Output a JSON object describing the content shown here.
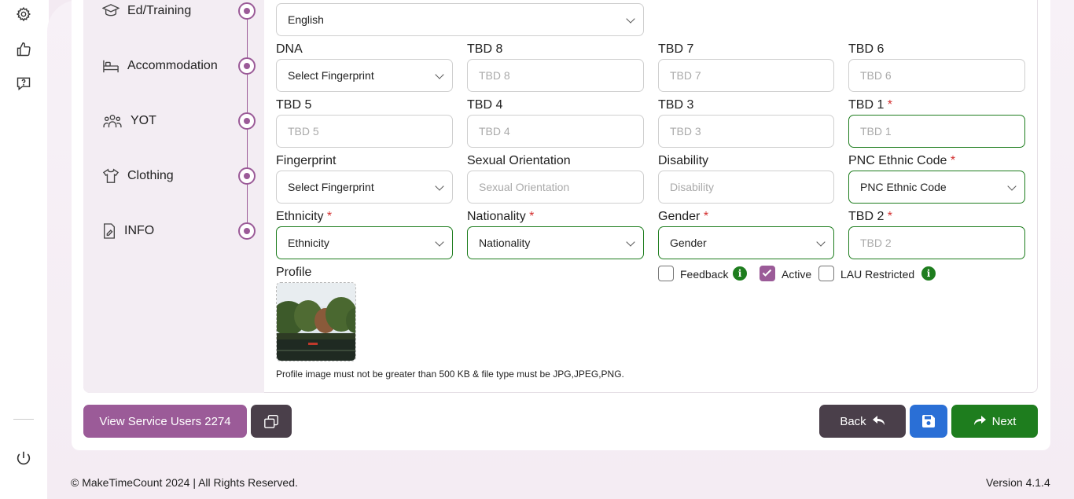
{
  "steps": [
    "Ed/Training",
    "Accommodation",
    "YOT",
    "Clothing",
    "INFO"
  ],
  "language": {
    "value": "English"
  },
  "fields": {
    "dna": {
      "label": "DNA",
      "value": "Select Fingerprint"
    },
    "tbd8": {
      "label": "TBD 8",
      "placeholder": "TBD 8"
    },
    "tbd7": {
      "label": "TBD 7",
      "placeholder": "TBD 7"
    },
    "tbd6": {
      "label": "TBD 6",
      "placeholder": "TBD 6"
    },
    "tbd5": {
      "label": "TBD 5",
      "placeholder": "TBD 5"
    },
    "tbd4": {
      "label": "TBD 4",
      "placeholder": "TBD 4"
    },
    "tbd3": {
      "label": "TBD 3",
      "placeholder": "TBD 3"
    },
    "tbd1": {
      "label": "TBD 1",
      "placeholder": "TBD 1"
    },
    "fingerprint": {
      "label": "Fingerprint",
      "value": "Select Fingerprint"
    },
    "sexual_orientation": {
      "label": "Sexual Orientation",
      "placeholder": "Sexual Orientation"
    },
    "disability": {
      "label": "Disability",
      "placeholder": "Disability"
    },
    "pnc_ethnic_code": {
      "label": "PNC Ethnic Code",
      "value": "PNC Ethnic Code"
    },
    "ethnicity": {
      "label": "Ethnicity",
      "value": "Ethnicity"
    },
    "nationality": {
      "label": "Nationality",
      "value": "Nationality"
    },
    "gender": {
      "label": "Gender",
      "value": "Gender"
    },
    "tbd2": {
      "label": "TBD 2",
      "placeholder": "TBD 2"
    }
  },
  "required_mark": "*",
  "checkboxes": {
    "feedback": "Feedback",
    "active": "Active",
    "lau_restricted": "LAU Restricted"
  },
  "info_glyph": "i",
  "profile": {
    "label": "Profile",
    "note": "Profile image must not be greater than 500 KB & file type must be JPG,JPEG,PNG."
  },
  "buttons": {
    "view_service_users": "View Service Users 2274",
    "back": "Back",
    "next": "Next"
  },
  "footer": {
    "copyright": "© MakeTimeCount 2024  |  All Rights Reserved.",
    "version": "Version 4.1.4"
  },
  "colors": {
    "accent": "#9b5b98",
    "green": "#1e7d1e",
    "blue": "#2a6fd6",
    "dark": "#4a3f4a"
  }
}
